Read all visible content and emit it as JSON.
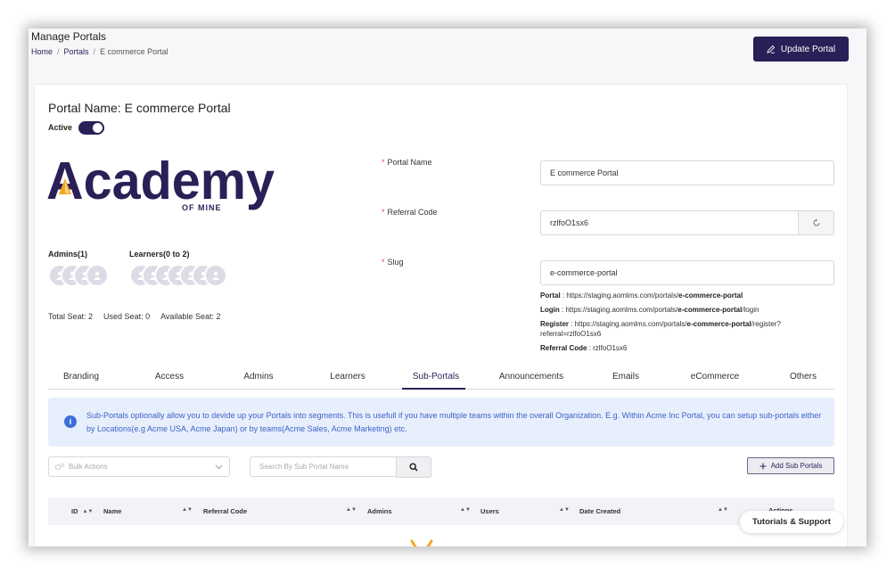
{
  "header": {
    "page_title": "Manage Portals",
    "breadcrumbs": [
      "Home",
      "Portals",
      "E commerce Portal"
    ],
    "update_button": "Update Portal"
  },
  "portal": {
    "heading": "Portal Name: E commerce Portal",
    "active_label": "Active",
    "active": true,
    "logo": {
      "wordmark": "Academy",
      "tagline": "OF MINE"
    },
    "admins_label": "Admins(1)",
    "learners_label": "Learners(0 to 2)",
    "seats": {
      "total": "Total Seat: 2",
      "used": "Used Seat: 0",
      "available": "Available Seat: 2"
    }
  },
  "form": {
    "portal_name_label": "Portal Name",
    "portal_name_value": "E commerce Portal",
    "referral_code_label": "Referral Code",
    "referral_code_value": "rzlfoO1sx6",
    "slug_label": "Slug",
    "slug_value": "e-commerce-portal",
    "links": {
      "portal_label": "Portal",
      "portal_base": " : https://staging.aomlms.com/portals/",
      "portal_slug": "e-commerce-portal",
      "login_label": "Login",
      "login_base": " : https://staging.aomlms.com/portals/",
      "login_slug": "e-commerce-portal",
      "login_suffix": "/login",
      "register_label": "Register",
      "register_base": " : https://staging.aomlms.com/portals/",
      "register_slug": "e-commerce-portal",
      "register_suffix": "/register?referral=rzlfoO1sx6",
      "referral_label": "Referral Code",
      "referral_value": " : rzlfoO1sx6"
    }
  },
  "tabs": [
    "Branding",
    "Access",
    "Admins",
    "Learners",
    "Sub-Portals",
    "Announcements",
    "Emails",
    "eCommerce",
    "Others"
  ],
  "active_tab": "Sub-Portals",
  "info_text": "Sub-Portals optionally allow you to devide up your Portals into segments. This is usefull if you have multiple teams within the overall Organization. E.g. Within Acme Inc Portal, you can setup sub-portals either by Locations(e.g Acme USA, Acme Japan) or by teams(Acme Sales, Acme Marketing) etc.",
  "toolbar": {
    "bulk_actions": "Bulk Actions",
    "search_placeholder": "Search By Sub Portal Name",
    "add_button": "Add Sub Portals"
  },
  "table": {
    "columns": [
      "ID",
      "Name",
      "Referral Code",
      "Admins",
      "Users",
      "Date Created",
      "Actions"
    ]
  },
  "support_button": "Tutorials & Support",
  "colors": {
    "brand": "#2a1f56",
    "accent": "#f5a623",
    "info_text": "#3b62c9",
    "info_bg": "#e8effc"
  }
}
